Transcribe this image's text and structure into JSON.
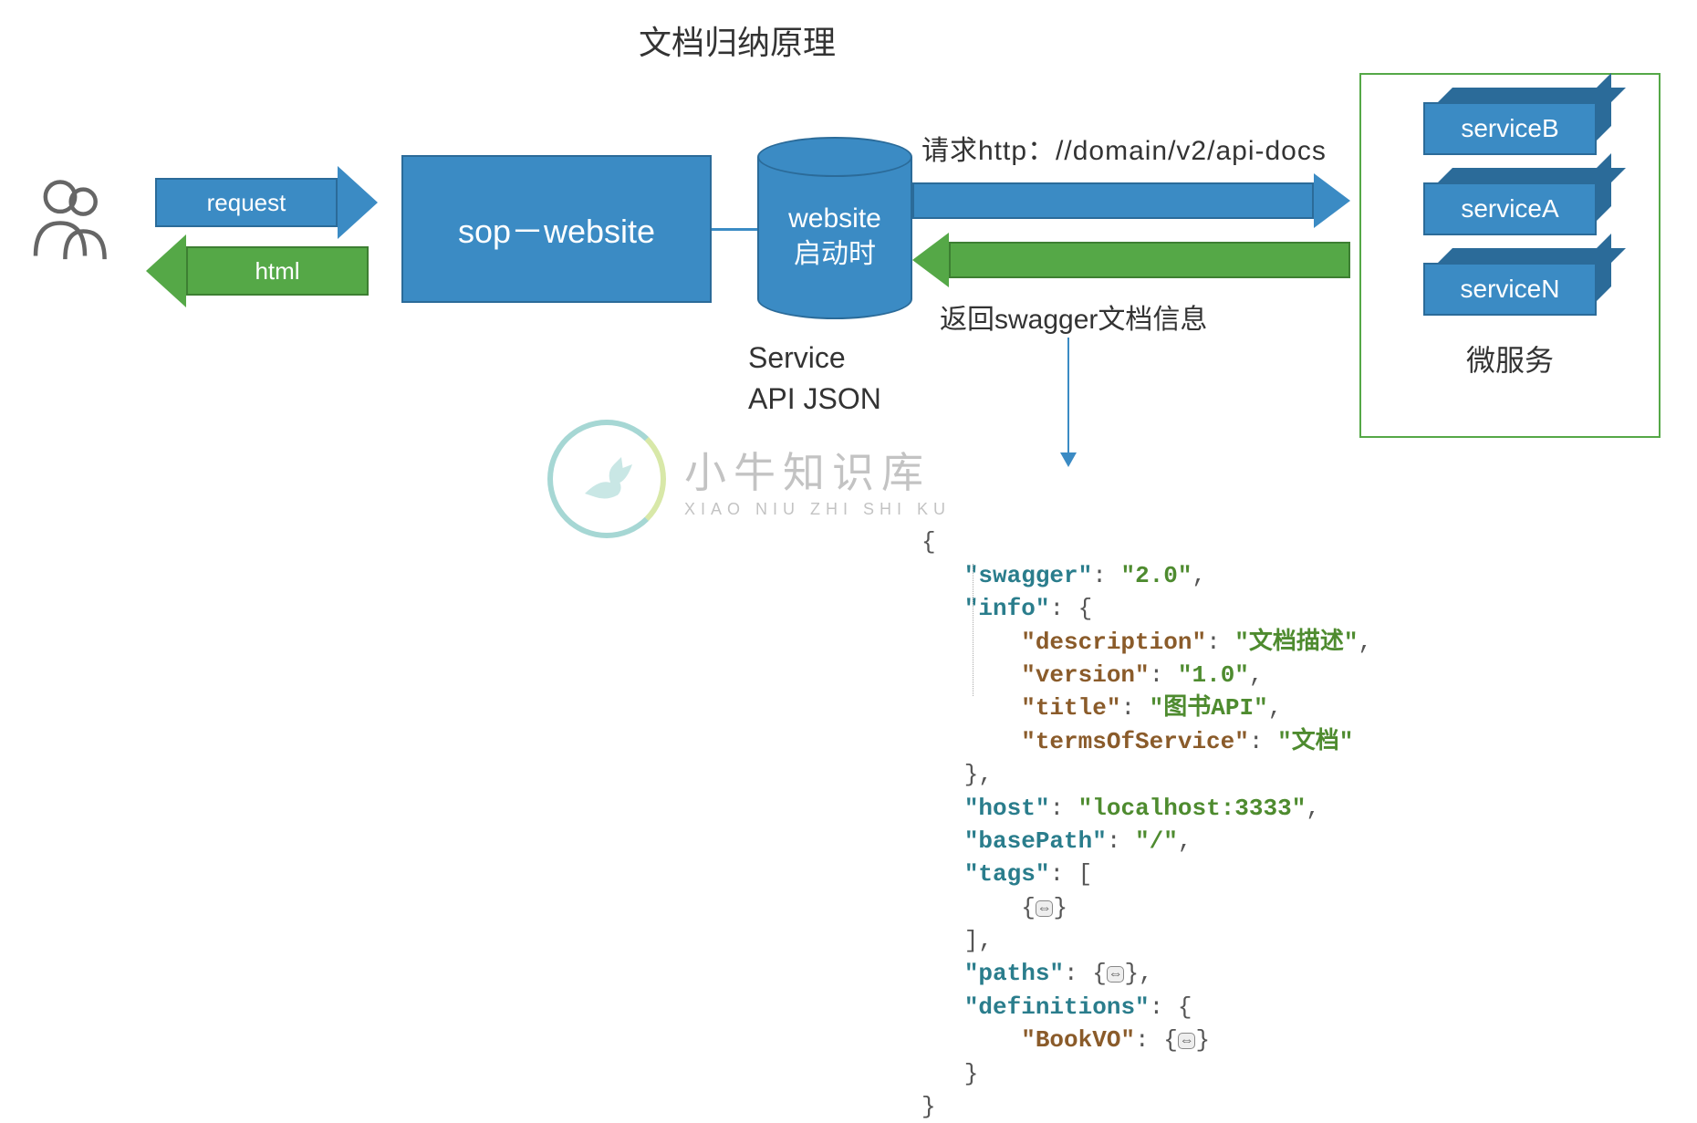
{
  "title": "文档归纳原理",
  "left": {
    "request_arrow_label": "request",
    "html_arrow_label": "html"
  },
  "sop_box_label": "sop－website",
  "cylinder": {
    "line1": "website",
    "line2": "启动时",
    "caption_line1": "Service",
    "caption_line2": "API JSON"
  },
  "right_arrows": {
    "request_label": "请求http：//domain/v2/api-docs",
    "response_label": "返回swagger文档信息"
  },
  "services": {
    "items": [
      "serviceB",
      "serviceA",
      "serviceN"
    ],
    "group_label": "微服务"
  },
  "watermark": {
    "cn": "小牛知识库",
    "en": "XIAO NIU ZHI SHI KU"
  },
  "json_sample": {
    "swagger": "2.0",
    "info": {
      "description": "文档描述",
      "version": "1.0",
      "title": "图书API",
      "termsOfService": "文档"
    },
    "host": "localhost:3333",
    "basePath": "/",
    "tags_folded": true,
    "paths_folded": true,
    "definitions": {
      "BookVO_folded": true
    }
  },
  "colors": {
    "blue": "#3b8bc4",
    "blue_dark": "#2b6b99",
    "green": "#55a847",
    "green_dark": "#3d7f32"
  }
}
